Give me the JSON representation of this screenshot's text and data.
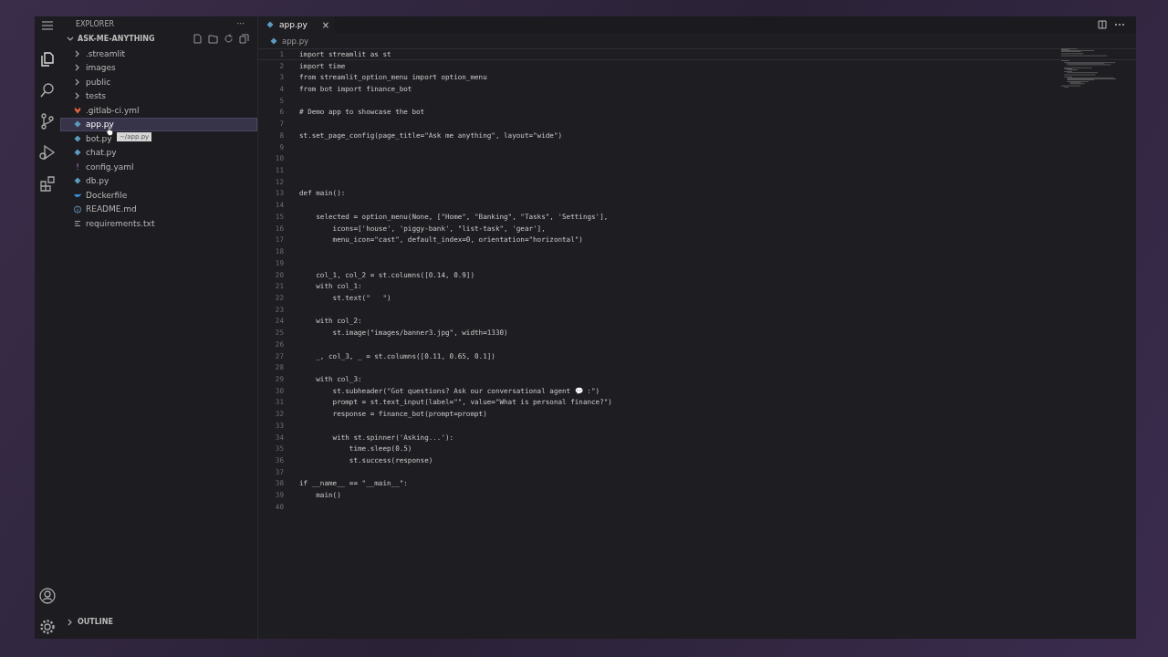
{
  "sidebar": {
    "title": "EXPLORER",
    "more": "···",
    "root": {
      "label": "ASK-ME-ANYTHING",
      "expanded": true
    },
    "items": [
      {
        "label": ".streamlit",
        "kind": "folder",
        "selected": false
      },
      {
        "label": "images",
        "kind": "folder",
        "selected": false
      },
      {
        "label": "public",
        "kind": "folder",
        "selected": false
      },
      {
        "label": "tests",
        "kind": "folder",
        "selected": false
      },
      {
        "label": ".gitlab-ci.yml",
        "kind": "gitlab",
        "selected": false
      },
      {
        "label": "app.py",
        "kind": "python",
        "selected": true
      },
      {
        "label": "bot.py",
        "kind": "python",
        "selected": false
      },
      {
        "label": "chat.py",
        "kind": "python",
        "selected": false
      },
      {
        "label": "config.yaml",
        "kind": "yaml",
        "icon": "!",
        "selected": false
      },
      {
        "label": "db.py",
        "kind": "python",
        "selected": false
      },
      {
        "label": "Dockerfile",
        "kind": "docker",
        "selected": false
      },
      {
        "label": "README.md",
        "kind": "info",
        "selected": false
      },
      {
        "label": "requirements.txt",
        "kind": "text",
        "selected": false
      }
    ],
    "tooltip": "~/app.py",
    "outline": {
      "label": "OUTLINE",
      "expanded": false
    }
  },
  "tabs": [
    {
      "label": "app.py",
      "close": "×",
      "selected": true
    }
  ],
  "breadcrumb": "app.py",
  "editor": {
    "lines": [
      {
        "number": "1",
        "text": "import streamlit as st"
      },
      {
        "number": "2",
        "text": "import time"
      },
      {
        "number": "3",
        "text": "from streamlit_option_menu import option_menu"
      },
      {
        "number": "4",
        "text": "from bot import finance_bot"
      },
      {
        "number": "5"
      },
      {
        "number": "6",
        "text": "# Demo app to showcase the bot"
      },
      {
        "number": "7"
      },
      {
        "number": "8",
        "text": "st.set_page_config(page_title=\"Ask me anything\", layout=\"wide\")"
      },
      {
        "number": "9"
      },
      {
        "number": "10"
      },
      {
        "number": "11"
      },
      {
        "number": "12"
      },
      {
        "number": "13",
        "text": "def main():"
      },
      {
        "number": "14"
      },
      {
        "number": "15",
        "text": "    selected = option_menu(None, [\"Home\", \"Banking\", \"Tasks\", 'Settings'],"
      },
      {
        "number": "16",
        "text": "        icons=['house', 'piggy-bank', \"list-task\", 'gear'],"
      },
      {
        "number": "17",
        "text": "        menu_icon=\"cast\", default_index=0, orientation=\"horizontal\")"
      },
      {
        "number": "18"
      },
      {
        "number": "19"
      },
      {
        "number": "20",
        "text": "    col_1, col_2 = st.columns([0.14, 0.9])"
      },
      {
        "number": "21",
        "text": "    with col_1:"
      },
      {
        "number": "22",
        "text": "        st.text(\"   \")"
      },
      {
        "number": "23"
      },
      {
        "number": "24",
        "text": "    with col_2:"
      },
      {
        "number": "25",
        "text": "        st.image(\"images/banner3.jpg\", width=1330)"
      },
      {
        "number": "26"
      },
      {
        "number": "27",
        "text": "    _, col_3, _ = st.columns([0.11, 0.65, 0.1])"
      },
      {
        "number": "28"
      },
      {
        "number": "29",
        "text": "    with col_3:"
      },
      {
        "number": "30",
        "text": "        st.subheader(\"Got questions? Ask our conversational agent 💬 :\")"
      },
      {
        "number": "31",
        "text": "        prompt = st.text_input(label=\"\", value=\"What is personal finance?\")"
      },
      {
        "number": "32",
        "text": "        response = finance_bot(prompt=prompt)"
      },
      {
        "number": "33"
      },
      {
        "number": "34",
        "text": "        with st.spinner('Asking...'):"
      },
      {
        "number": "35",
        "text": "            time.sleep(0.5)"
      },
      {
        "number": "36",
        "text": "            st.success(response)"
      },
      {
        "number": "37"
      },
      {
        "number": "38",
        "text": "if __name__ == \"__main__\":"
      },
      {
        "number": "39",
        "text": "    main()"
      },
      {
        "number": "40"
      }
    ]
  }
}
